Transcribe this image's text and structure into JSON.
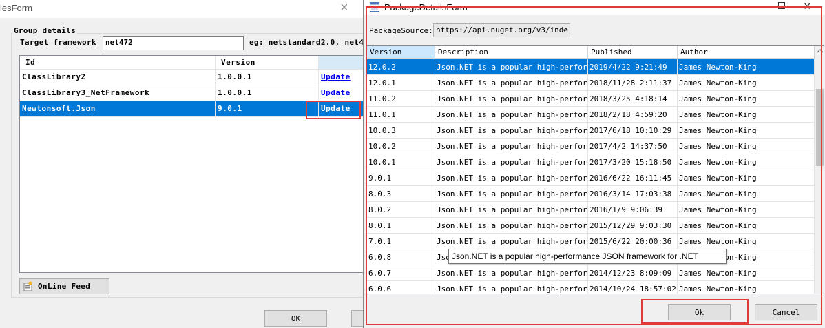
{
  "colors": {
    "accent": "#0078d7",
    "highlight": "#e03a3a",
    "link": "#0000ee",
    "header_active": "#cce8ff"
  },
  "left_window": {
    "title": "iesForm",
    "group_label": "Group details",
    "target_framework_label": "Target framework",
    "target_framework_value": "net472",
    "target_framework_hint": "eg: netstandard2.0, net4",
    "grid": {
      "columns": [
        "Id",
        "Version",
        ""
      ],
      "rows": [
        {
          "id": "ClassLibrary2",
          "version": "1.0.0.1",
          "action": "Update",
          "selected": false
        },
        {
          "id": "ClassLibrary3_NetFramework",
          "version": "1.0.0.1",
          "action": "Update",
          "selected": false
        },
        {
          "id": "Newtonsoft.Json",
          "version": "9.0.1",
          "action": "Update",
          "selected": true
        }
      ]
    },
    "online_feed_label": "OnLine Feed",
    "online_feed_icon": "feed-icon",
    "ok_label": "OK"
  },
  "right_window": {
    "title": "PackageDetailsForm",
    "package_source_label": "PackageSource:",
    "package_source_value": "https://api.nuget.org/v3/inde",
    "grid": {
      "columns": [
        "Version",
        "Description",
        "Published",
        "Author"
      ],
      "rows": [
        {
          "version": "12.0.2",
          "description": "Json.NET is a popular high-perfor...",
          "published": "2019/4/22 9:21:49",
          "author": "James Newton-King",
          "selected": true
        },
        {
          "version": "12.0.1",
          "description": "Json.NET is a popular high-perfor...",
          "published": "2018/11/28 2:11:37",
          "author": "James Newton-King",
          "selected": false
        },
        {
          "version": "11.0.2",
          "description": "Json.NET is a popular high-perfor...",
          "published": "2018/3/25 4:18:14",
          "author": "James Newton-King",
          "selected": false
        },
        {
          "version": "11.0.1",
          "description": "Json.NET is a popular high-perfor...",
          "published": "2018/2/18 4:59:20",
          "author": "James Newton-King",
          "selected": false
        },
        {
          "version": "10.0.3",
          "description": "Json.NET is a popular high-perfor...",
          "published": "2017/6/18 10:10:29",
          "author": "James Newton-King",
          "selected": false
        },
        {
          "version": "10.0.2",
          "description": "Json.NET is a popular high-perfor...",
          "published": "2017/4/2 14:37:50",
          "author": "James Newton-King",
          "selected": false
        },
        {
          "version": "10.0.1",
          "description": "Json.NET is a popular high-perfor...",
          "published": "2017/3/20 15:18:50",
          "author": "James Newton-King",
          "selected": false
        },
        {
          "version": "9.0.1",
          "description": "Json.NET is a popular high-perfor...",
          "published": "2016/6/22 16:11:45",
          "author": "James Newton-King",
          "selected": false
        },
        {
          "version": "8.0.3",
          "description": "Json.NET is a popular high-perfor...",
          "published": "2016/3/14 17:03:38",
          "author": "James Newton-King",
          "selected": false
        },
        {
          "version": "8.0.2",
          "description": "Json.NET is a popular high-perfor...",
          "published": "2016/1/9 9:06:39",
          "author": "James Newton-King",
          "selected": false
        },
        {
          "version": "8.0.1",
          "description": "Json.NET is a popular high-perfor...",
          "published": "2015/12/29 9:03:30",
          "author": "James Newton-King",
          "selected": false
        },
        {
          "version": "7.0.1",
          "description": "Json.NET is a popular high-perfor...",
          "published": "2015/6/22 20:00:36",
          "author": "James Newton-King",
          "selected": false
        },
        {
          "version": "6.0.8",
          "description": "Json.NET is a popular high-perfor...",
          "published": "",
          "author": "James Newton-King",
          "selected": false
        },
        {
          "version": "6.0.7",
          "description": "Json.NET is a popular high-perfor...",
          "published": "2014/12/23 8:09:09",
          "author": "James Newton-King",
          "selected": false
        },
        {
          "version": "6.0.6",
          "description": "Json.NET is a popular high-perfor...",
          "published": "2014/10/24 18:57:02",
          "author": "James Newton-King",
          "selected": false
        }
      ]
    },
    "tooltip": "Json.NET is a popular high-performance JSON framework for .NET",
    "ok_label": "Ok",
    "cancel_label": "Cancel"
  }
}
